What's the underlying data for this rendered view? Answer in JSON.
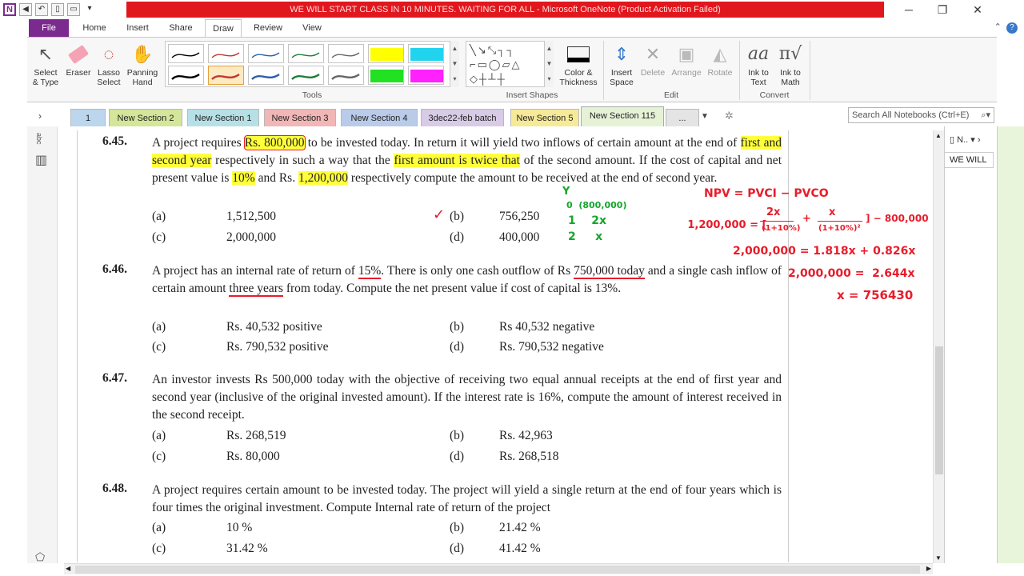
{
  "window": {
    "title": "WE WILL START CLASS IN 10 MINUTES. WAITING FOR ALL  -  Microsoft OneNote (Product Activation Failed)"
  },
  "ribbon_tabs": [
    "File",
    "Home",
    "Insert",
    "Share",
    "Draw",
    "Review",
    "View"
  ],
  "ribbon": {
    "select_type": "Select\n& Type",
    "eraser": "Eraser",
    "lasso": "Lasso\nSelect",
    "panning": "Panning\nHand",
    "tools_label": "Tools",
    "color_thickness": "Color &\nThickness",
    "insert_shapes_label": "Insert Shapes",
    "insert_space": "Insert\nSpace",
    "delete": "Delete",
    "arrange": "Arrange",
    "rotate": "Rotate",
    "edit_label": "Edit",
    "ink_to_text": "Ink to\nText",
    "ink_to_math": "Ink to\nMath",
    "convert_label": "Convert",
    "pen_colors": [
      "#000000",
      "#c0392b",
      "#2e5fa8",
      "#1e7e34",
      "#666666",
      "#ffff00",
      "#22d3ee",
      "#000000",
      "#c0392b",
      "#2e5fa8",
      "#1e7e34",
      "#666666",
      "#22e022",
      "#ff22ff"
    ]
  },
  "sections": [
    {
      "label": "1",
      "color": "#bcd6ee"
    },
    {
      "label": "New Section 2",
      "color": "#d4e69a"
    },
    {
      "label": "New Section 1",
      "color": "#b6e0e6"
    },
    {
      "label": "New Section 3",
      "color": "#f1b6b6"
    },
    {
      "label": "New Section 4",
      "color": "#b9cbe8"
    },
    {
      "label": "3dec22-feb batch",
      "color": "#d8cbe6"
    },
    {
      "label": "New Section 5",
      "color": "#f6ea98"
    },
    {
      "label": "New Section 115",
      "color": "#e6f2d6"
    },
    {
      "label": "...",
      "color": "#e4e4e4"
    }
  ],
  "search_placeholder": "Search All Notebooks (Ctrl+E)",
  "right_panel": {
    "notebook_short": "N..",
    "page_title": "WE WILL"
  },
  "questions": [
    {
      "num": "6.45.",
      "parts": [
        {
          "t": "A project requires ",
          "h": ""
        },
        {
          "t": "Rs. 800,000",
          "h": "yr"
        },
        {
          "t": " to be invested today. In return it will yield two inflows of certain amount at the end of ",
          "h": ""
        },
        {
          "t": "first and second year",
          "h": "y"
        },
        {
          "t": " respectively in such a way that the ",
          "h": ""
        },
        {
          "t": "first amount is twice that",
          "h": "y"
        },
        {
          "t": " of the second amount. If the cost of capital and net present value is ",
          "h": ""
        },
        {
          "t": "10%",
          "h": "y"
        },
        {
          "t": " and Rs. ",
          "h": ""
        },
        {
          "t": "1,200,000",
          "h": "y"
        },
        {
          "t": " respectively compute the amount to be received at the end of second year.",
          "h": ""
        }
      ],
      "options": [
        {
          "label": "(a)",
          "value": "1,512,500"
        },
        {
          "label": "(b)",
          "value": "756,250"
        },
        {
          "label": "(c)",
          "value": "2,000,000"
        },
        {
          "label": "(d)",
          "value": "400,000"
        }
      ]
    },
    {
      "num": "6.46.",
      "parts": [
        {
          "t": "A project has an internal rate of return of ",
          "h": ""
        },
        {
          "t": "15%",
          "h": "r"
        },
        {
          "t": ". There is only one cash outflow of Rs ",
          "h": ""
        },
        {
          "t": "750,000 today",
          "h": "r"
        },
        {
          "t": " and a single cash inflow of certain amount ",
          "h": ""
        },
        {
          "t": "three years",
          "h": "r"
        },
        {
          "t": " from today. Compute the net present value if cost of capital is 13%.",
          "h": ""
        }
      ],
      "options": [
        {
          "label": "(a)",
          "value": "Rs. 40,532 positive"
        },
        {
          "label": "(b)",
          "value": "Rs 40,532 negative"
        },
        {
          "label": "(c)",
          "value": "Rs. 790,532 positive"
        },
        {
          "label": "(d)",
          "value": "Rs. 790,532 negative"
        }
      ]
    },
    {
      "num": "6.47.",
      "parts": [
        {
          "t": "An investor invests Rs 500,000 today with the objective of receiving two equal annual receipts at the end of first year and second year (inclusive of the original invested amount). If the interest rate is 16%, compute the amount of interest received in the second receipt.",
          "h": ""
        }
      ],
      "options": [
        {
          "label": "(a)",
          "value": "Rs. 268,519"
        },
        {
          "label": "(b)",
          "value": "Rs. 42,963"
        },
        {
          "label": "(c)",
          "value": "Rs. 80,000"
        },
        {
          "label": "(d)",
          "value": "Rs. 268,518"
        }
      ]
    },
    {
      "num": "6.48.",
      "parts": [
        {
          "t": "A project requires certain amount to be invested today. The project will yield a single return at the end of four years which is four times the original investment. Compute Internal rate of return of the project",
          "h": ""
        }
      ],
      "options": [
        {
          "label": "(a)",
          "value": "10 %"
        },
        {
          "label": "(b)",
          "value": "21.42 %"
        },
        {
          "label": "(c)",
          "value": "31.42 %"
        },
        {
          "label": "(d)",
          "value": "41.42 %"
        }
      ]
    }
  ],
  "ink": {
    "green_y": "Y",
    "green_r0": "0  (800,000)",
    "green_r1": "1    2x",
    "green_r2": "2     x",
    "red_npv": "NPV = PVCI − PVCO",
    "red_l2a": "1,200,000 = [",
    "red_l2b": "2x",
    "red_l2c": "(1+10%)",
    "red_l2d": "+",
    "red_l2e": "x",
    "red_l2f": "(1+10%)²",
    "red_l2g": "] − 800,000",
    "red_l3": "2,000,000 = 1.818x + 0.826x",
    "red_l4": "2,000,000 =  2.644x",
    "red_l5": "x = 756430",
    "checkmark": "✓"
  }
}
